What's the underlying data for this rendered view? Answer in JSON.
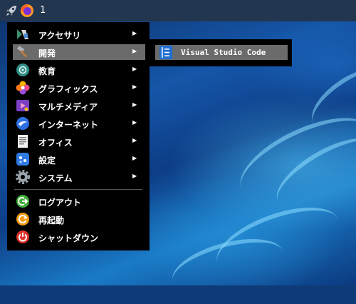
{
  "panel": {
    "launcher_icon": "rocket-icon",
    "browser_icon": "firefox-icon",
    "workspace_number": "1"
  },
  "menu": {
    "items": [
      {
        "label": "アクセサリ",
        "icon": "accessories-icon",
        "arrow": "▶"
      },
      {
        "label": "開発",
        "icon": "development-hammer-icon",
        "arrow": "▶",
        "selected": true
      },
      {
        "label": "教育",
        "icon": "education-icon",
        "arrow": "▶"
      },
      {
        "label": "グラフィックス",
        "icon": "graphics-icon",
        "arrow": "▶"
      },
      {
        "label": "マルチメディア",
        "icon": "multimedia-icon",
        "arrow": "▶"
      },
      {
        "label": "インターネット",
        "icon": "internet-icon",
        "arrow": "▶"
      },
      {
        "label": "オフィス",
        "icon": "office-document-icon",
        "arrow": "▶"
      },
      {
        "label": "設定",
        "icon": "settings-icon",
        "arrow": "▶"
      },
      {
        "label": "システム",
        "icon": "system-gear-icon",
        "arrow": "▶"
      },
      {
        "label": "ログアウト",
        "icon": "logout-icon"
      },
      {
        "label": "再起動",
        "icon": "reboot-icon"
      },
      {
        "label": "シャットダウン",
        "icon": "shutdown-icon"
      }
    ]
  },
  "submenu": {
    "items": [
      {
        "label": "Visual Studio Code",
        "icon": "vscode-icon"
      }
    ]
  },
  "colors": {
    "menu_bg": "#000000",
    "selected_bg": "#6b6b6b",
    "panel_bg": "#23364f"
  }
}
